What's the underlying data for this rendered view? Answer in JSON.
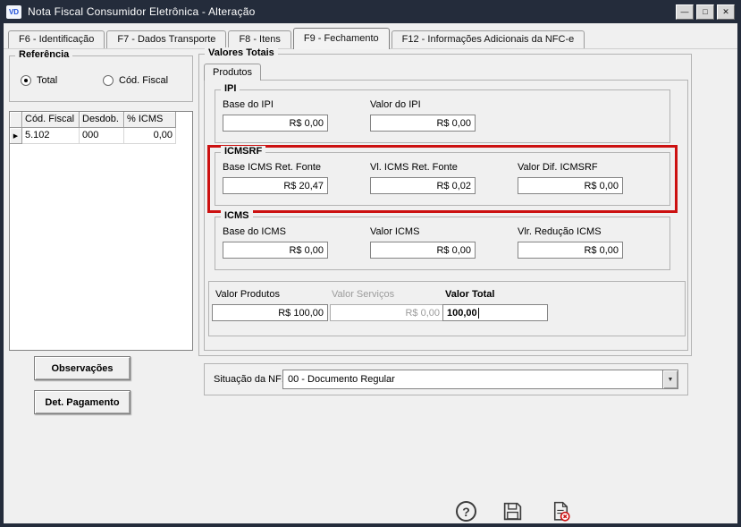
{
  "window": {
    "title": "Nota Fiscal Consumidor Eletrônica - Alteração",
    "icon_label": "VD"
  },
  "icons": {
    "minimize": "—",
    "maximize": "□",
    "close": "✕",
    "help": "?",
    "dropdown_arrow": "▼",
    "row_selector": "▶"
  },
  "colors": {
    "titlebar": "#242c3b",
    "face": "#f0f0f0",
    "highlight_red": "#cc1111",
    "field_border": "#848484"
  },
  "tabs": {
    "items": [
      {
        "label": "F6 - Identificação",
        "active": false
      },
      {
        "label": "F7 - Dados Transporte",
        "active": false
      },
      {
        "label": "F8 - Itens",
        "active": false
      },
      {
        "label": "F9 - Fechamento",
        "active": true
      },
      {
        "label": "F12 - Informações Adicionais da NFC-e",
        "active": false
      }
    ]
  },
  "referencia": {
    "title": "Referência",
    "options": [
      {
        "label": "Total",
        "selected": true
      },
      {
        "label": "Cód. Fiscal",
        "selected": false
      }
    ]
  },
  "grid": {
    "columns": [
      "Cód. Fiscal",
      "Desdob.",
      "% ICMS"
    ],
    "rows": [
      [
        "5.102",
        "000",
        "0,00"
      ]
    ]
  },
  "buttons": {
    "observacoes": "Observações",
    "det_pagamento": "Det. Pagamento"
  },
  "valores": {
    "title": "Valores Totais",
    "tab_label": "Produtos",
    "groups": [
      {
        "title": "IPI",
        "fields": [
          {
            "label": "Base do IPI",
            "value": "R$ 0,00"
          },
          {
            "label": "Valor do IPI",
            "value": "R$ 0,00"
          }
        ]
      },
      {
        "title": "ICMSRF",
        "highlighted": true,
        "fields": [
          {
            "label": "Base ICMS Ret. Fonte",
            "value": "R$ 20,47"
          },
          {
            "label": "Vl. ICMS Ret. Fonte",
            "value": "R$ 0,02"
          },
          {
            "label": "Valor Dif. ICMSRF",
            "value": "R$ 0,00"
          }
        ]
      },
      {
        "title": "ICMS",
        "fields": [
          {
            "label": "Base do ICMS",
            "value": "R$ 0,00"
          },
          {
            "label": "Valor ICMS",
            "value": "R$ 0,00"
          },
          {
            "label": "Vlr. Redução ICMS",
            "value": "R$ 0,00"
          }
        ]
      }
    ],
    "totals": {
      "produtos": {
        "label": "Valor Produtos",
        "value": "R$ 100,00"
      },
      "servicos": {
        "label": "Valor Serviços",
        "value": "R$ 0,00",
        "disabled": true
      },
      "total": {
        "label": "Valor Total",
        "value": "100,00"
      }
    }
  },
  "situacao": {
    "label": "Situação da NF:",
    "value": "00 - Documento Regular"
  }
}
